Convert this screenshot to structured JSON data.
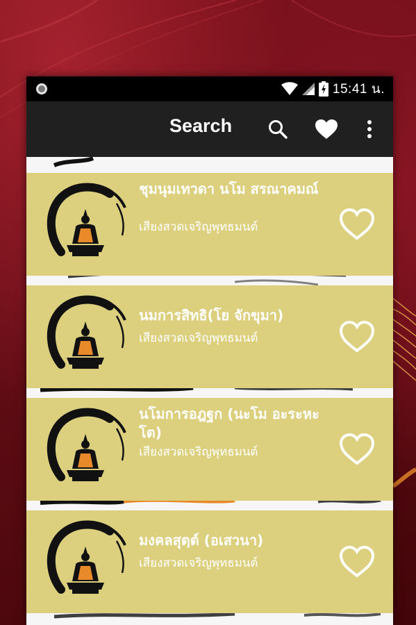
{
  "status_bar": {
    "time": "15:41 น."
  },
  "toolbar": {
    "title": "Search",
    "icons": [
      "search-icon",
      "heart-icon",
      "more-vert-icon"
    ]
  },
  "list": {
    "items": [
      {
        "title": "ชุมนุมเทวดา นโม สรณาคมณ์",
        "subtitle": "เสียงสวดเจริญพุทธมนต์",
        "favorite": false
      },
      {
        "title": "นมการสิทธิ(โย จักขุมา)",
        "subtitle": "เสียงสวดเจริญพุทธมนต์",
        "favorite": false
      },
      {
        "title": "นโมการอฎฐก (นะโม อะระหะโต)",
        "subtitle": "เสียงสวดเจริญพุทธมนต์",
        "favorite": false
      },
      {
        "title": "มงคลสุตฺต์ (อเสวนา)",
        "subtitle": "เสียงสวดเจริญพุทธมนต์",
        "favorite": false
      }
    ]
  },
  "colors": {
    "card": "#dcd07e",
    "toolbar": "#202020",
    "robe": "#e8892a",
    "background": "#7a111b"
  }
}
